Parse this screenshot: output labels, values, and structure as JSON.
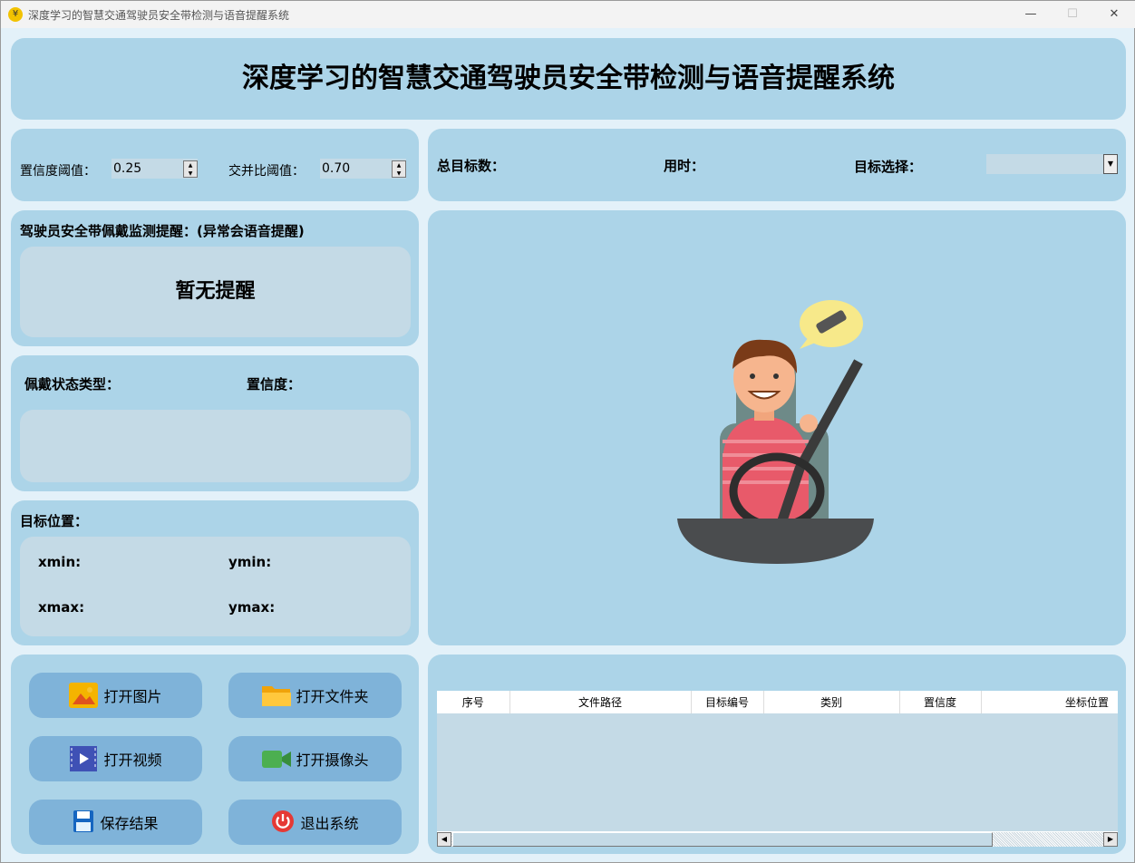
{
  "window": {
    "title": "深度学习的智慧交通驾驶员安全带检测与语音提醒系统",
    "minimize": "—",
    "maximize": "☐",
    "close": "✕"
  },
  "header": {
    "title": "深度学习的智慧交通驾驶员安全带检测与语音提醒系统"
  },
  "params": {
    "conf_label": "置信度阈值：",
    "conf_value": "0.25",
    "iou_label": "交并比阈值：",
    "iou_value": "0.70"
  },
  "stats": {
    "total_label": "总目标数：",
    "time_label": "用时：",
    "select_label": "目标选择：",
    "select_value": ""
  },
  "alert": {
    "title": "驾驶员安全带佩戴监测提醒：(异常会语音提醒)",
    "message": "暂无提醒"
  },
  "status": {
    "type_label": "佩戴状态类型：",
    "conf_label": "置信度："
  },
  "position": {
    "title": "目标位置：",
    "xmin": "xmin:",
    "ymin": "ymin:",
    "xmax": "xmax:",
    "ymax": "ymax:"
  },
  "buttons": {
    "open_image": "打开图片",
    "open_folder": "打开文件夹",
    "open_video": "打开视频",
    "open_camera": "打开摄像头",
    "save": "保存结果",
    "exit": "退出系统"
  },
  "table": {
    "columns": [
      "序号",
      "文件路径",
      "目标编号",
      "类别",
      "置信度",
      "坐标位置"
    ],
    "rows": []
  },
  "colors": {
    "panel": "#acd4e8",
    "inner": "#c4dae6",
    "button": "#7fb3d9"
  }
}
